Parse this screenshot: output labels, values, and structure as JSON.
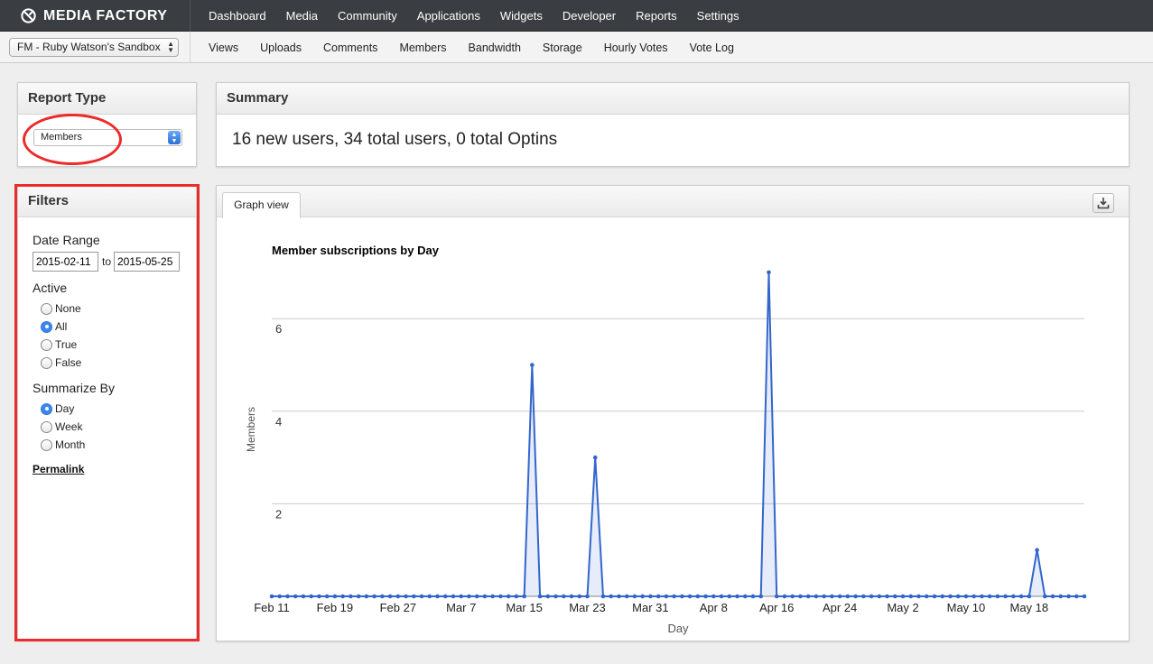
{
  "brand": {
    "name": "MEDIA FACTORY"
  },
  "topnav": [
    "Dashboard",
    "Media",
    "Community",
    "Applications",
    "Widgets",
    "Developer",
    "Reports",
    "Settings"
  ],
  "sandbox": {
    "selected": "FM - Ruby Watson's Sandbox"
  },
  "subnav": [
    "Views",
    "Uploads",
    "Comments",
    "Members",
    "Bandwidth",
    "Storage",
    "Hourly Votes",
    "Vote Log"
  ],
  "report_type": {
    "title": "Report Type",
    "selected": "Members"
  },
  "summary": {
    "title": "Summary",
    "text": "16 new users, 34 total users, 0 total Optins"
  },
  "filters": {
    "title": "Filters",
    "date_range_label": "Date Range",
    "date_from": "2015-02-11",
    "date_to_label": "to",
    "date_to": "2015-05-25",
    "active_label": "Active",
    "active_options": [
      "None",
      "All",
      "True",
      "False"
    ],
    "active_selected": "All",
    "summarize_label": "Summarize By",
    "summarize_options": [
      "Day",
      "Week",
      "Month"
    ],
    "summarize_selected": "Day",
    "permalink": "Permalink"
  },
  "graph": {
    "tab_label": "Graph view",
    "download_icon": "download-icon"
  },
  "annotation_color": "#ec2b2b",
  "chart_data": {
    "type": "area",
    "title": "Member subscriptions by Day",
    "xlabel": "Day",
    "ylabel": "Members",
    "x_start": "2015-02-11",
    "x_end": "2015-05-25",
    "xtick_labels": [
      "Feb 11",
      "Feb 19",
      "Feb 27",
      "Mar 7",
      "Mar 15",
      "Mar 23",
      "Mar 31",
      "Apr 8",
      "Apr 16",
      "Apr 24",
      "May 2",
      "May 10",
      "May 18"
    ],
    "yticks": [
      2,
      4,
      6
    ],
    "ylim": [
      0,
      7
    ],
    "grid": true,
    "line_color": "#3366cc",
    "series": [
      {
        "values_nonzero": [
          {
            "date": "2015-03-16",
            "value": 5
          },
          {
            "date": "2015-03-24",
            "value": 3
          },
          {
            "date": "2015-04-15",
            "value": 7
          },
          {
            "date": "2015-05-19",
            "value": 1
          }
        ],
        "default_value": 0
      }
    ]
  }
}
